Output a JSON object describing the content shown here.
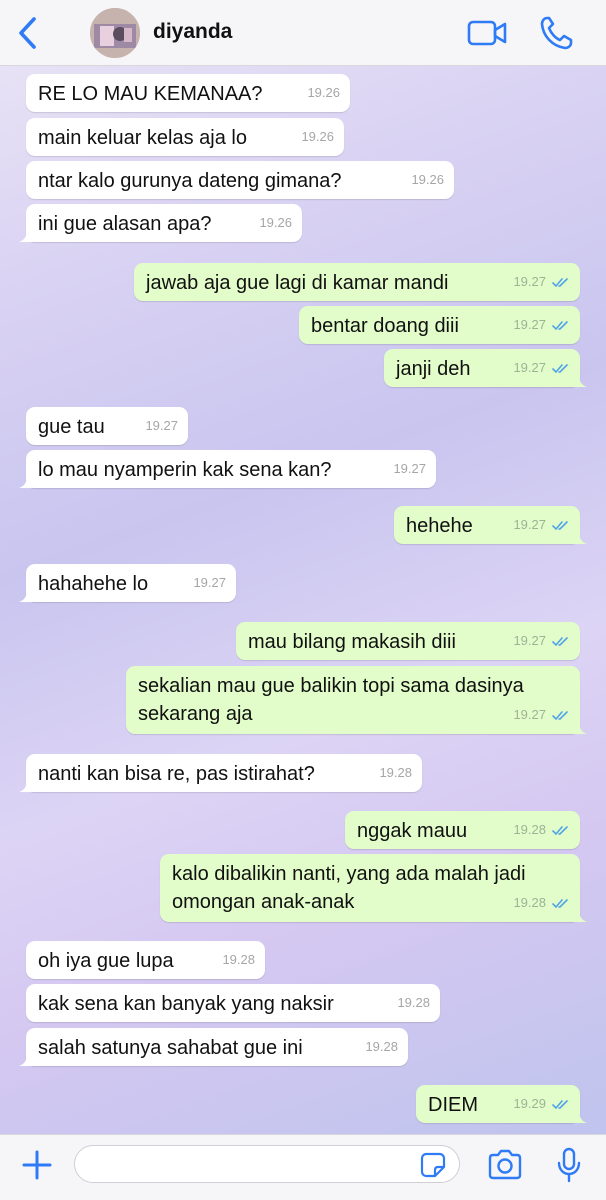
{
  "header": {
    "contact_name": "diyanda",
    "back_icon": "chevron-left-icon",
    "video_icon": "video-camera-icon",
    "call_icon": "phone-icon",
    "accent": "#2f7bf6"
  },
  "messages": [
    {
      "dir": "in",
      "lines": [
        "RE LO MAU KEMANAA?"
      ],
      "time": "19.26"
    },
    {
      "dir": "in",
      "lines": [
        "main keluar kelas aja lo"
      ],
      "time": "19.26"
    },
    {
      "dir": "in",
      "lines": [
        "ntar kalo gurunya dateng gimana?"
      ],
      "time": "19.26"
    },
    {
      "dir": "in",
      "lines": [
        "ini gue alasan apa?"
      ],
      "time": "19.26"
    },
    {
      "dir": "out",
      "lines": [
        "jawab aja gue lagi di kamar mandi"
      ],
      "time": "19.27"
    },
    {
      "dir": "out",
      "lines": [
        "bentar doang diii"
      ],
      "time": "19.27"
    },
    {
      "dir": "out",
      "lines": [
        "janji deh"
      ],
      "time": "19.27"
    },
    {
      "dir": "in",
      "lines": [
        "gue tau"
      ],
      "time": "19.27"
    },
    {
      "dir": "in",
      "lines": [
        "lo mau nyamperin kak sena kan?"
      ],
      "time": "19.27"
    },
    {
      "dir": "out",
      "lines": [
        "hehehe"
      ],
      "time": "19.27"
    },
    {
      "dir": "in",
      "lines": [
        "hahahehe lo"
      ],
      "time": "19.27"
    },
    {
      "dir": "out",
      "lines": [
        "mau bilang makasih diii"
      ],
      "time": "19.27"
    },
    {
      "dir": "out",
      "lines": [
        "sekalian mau gue balikin topi sama dasinya",
        "sekarang aja"
      ],
      "time": "19.27"
    },
    {
      "dir": "in",
      "lines": [
        "nanti kan bisa re, pas istirahat?"
      ],
      "time": "19.28"
    },
    {
      "dir": "out",
      "lines": [
        "nggak mauu"
      ],
      "time": "19.28"
    },
    {
      "dir": "out",
      "lines": [
        "kalo dibalikin nanti, yang ada malah jadi",
        "omongan anak-anak"
      ],
      "time": "19.28"
    },
    {
      "dir": "in",
      "lines": [
        "oh iya gue lupa"
      ],
      "time": "19.28"
    },
    {
      "dir": "in",
      "lines": [
        "kak sena kan banyak yang naksir"
      ],
      "time": "19.28"
    },
    {
      "dir": "in",
      "lines": [
        "salah satunya sahabat gue ini"
      ],
      "time": "19.28"
    },
    {
      "dir": "out",
      "lines": [
        "DIEM"
      ],
      "time": "19.29"
    }
  ],
  "inputbar": {
    "placeholder": "",
    "plus_icon": "plus-icon",
    "sticker_icon": "sticker-icon",
    "camera_icon": "camera-icon",
    "mic_icon": "microphone-icon"
  },
  "colors": {
    "incoming_bubble": "#ffffff",
    "outgoing_bubble": "#e2fdc9",
    "read_ticks": "#4fa3e8"
  }
}
